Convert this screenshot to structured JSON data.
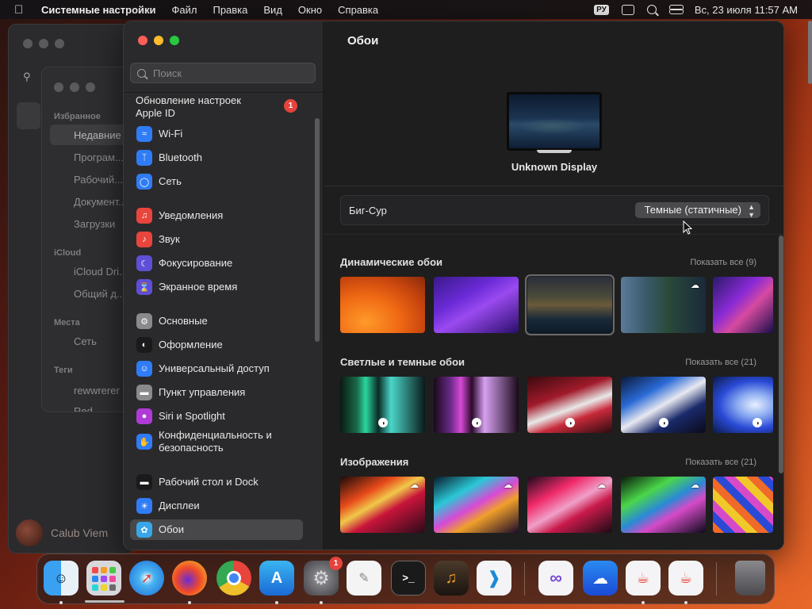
{
  "menubar": {
    "app": "Системные настройки",
    "menus": [
      "Файл",
      "Правка",
      "Вид",
      "Окно",
      "Справка"
    ],
    "input_source": "РУ",
    "datetime": "Вс, 23 июля  11:57 AM"
  },
  "finder": {
    "sections": [
      "Избранное",
      "iCloud",
      "Места",
      "Теги"
    ],
    "items": [
      "Недавние",
      "Програм...",
      "Рабочий...",
      "Документ...",
      "Загрузки",
      "iCloud Dri...",
      "Общий д...",
      "Сеть",
      "rewwrerer",
      "Red"
    ],
    "user": "Calub Viem"
  },
  "sidebar": {
    "search_placeholder": "Поиск",
    "apple_id": "Обновление настроек Apple ID",
    "apple_id_badge": "1",
    "items": [
      {
        "label": "Wi-Fi",
        "icon": "wifi-icon",
        "color": "#2f7cf6"
      },
      {
        "label": "Bluetooth",
        "icon": "bluetooth-icon",
        "color": "#2f7cf6"
      },
      {
        "label": "Сеть",
        "icon": "globe-icon",
        "color": "#2f7cf6"
      },
      {
        "label": "Уведомления",
        "icon": "bell-icon",
        "color": "#e8453c"
      },
      {
        "label": "Звук",
        "icon": "speaker-icon",
        "color": "#e8453c"
      },
      {
        "label": "Фокусирование",
        "icon": "moon-icon",
        "color": "#5e4fd6"
      },
      {
        "label": "Экранное время",
        "icon": "hourglass-icon",
        "color": "#5e4fd6"
      },
      {
        "label": "Основные",
        "icon": "gear-icon",
        "color": "#8a8a8e"
      },
      {
        "label": "Оформление",
        "icon": "appearance-icon",
        "color": "#1a1a1a"
      },
      {
        "label": "Универсальный доступ",
        "icon": "accessibility-icon",
        "color": "#2f7cf6"
      },
      {
        "label": "Пункт управления",
        "icon": "control-center-icon",
        "color": "#8a8a8e"
      },
      {
        "label": "Siri и Spotlight",
        "icon": "siri-icon",
        "color": "#b03ad6"
      },
      {
        "label": "Конфиденциальность и безопасность",
        "icon": "hand-icon",
        "color": "#2f7cf6"
      },
      {
        "label": "Рабочий стол и Dock",
        "icon": "dock-icon",
        "color": "#1a1a1a"
      },
      {
        "label": "Дисплеи",
        "icon": "sun-icon",
        "color": "#2f7cf6"
      },
      {
        "label": "Обои",
        "icon": "wallpaper-icon",
        "color": "#38a6e8"
      }
    ]
  },
  "content": {
    "title": "Обои",
    "display_name": "Unknown Display",
    "current_wallpaper": "Биг-Сур",
    "style_value": "Темные (статичные)",
    "sections": [
      {
        "title": "Динамические обои",
        "show_all": "Показать все (9)"
      },
      {
        "title": "Светлые и темные обои",
        "show_all": "Показать все (21)"
      },
      {
        "title": "Изображения",
        "show_all": "Показать все (21)"
      }
    ]
  },
  "dock": {
    "apps": [
      "Finder",
      "Launchpad",
      "Safari",
      "Firefox",
      "Chrome",
      "App Store",
      "Системные настройки",
      "TextEdit",
      "Терминал",
      "GarageBand",
      "VS Code",
      "Visual Studio",
      "Погода",
      "Java",
      "Java",
      "Корзина"
    ],
    "settings_badge": "1",
    "terminal_prompt": ">_"
  }
}
